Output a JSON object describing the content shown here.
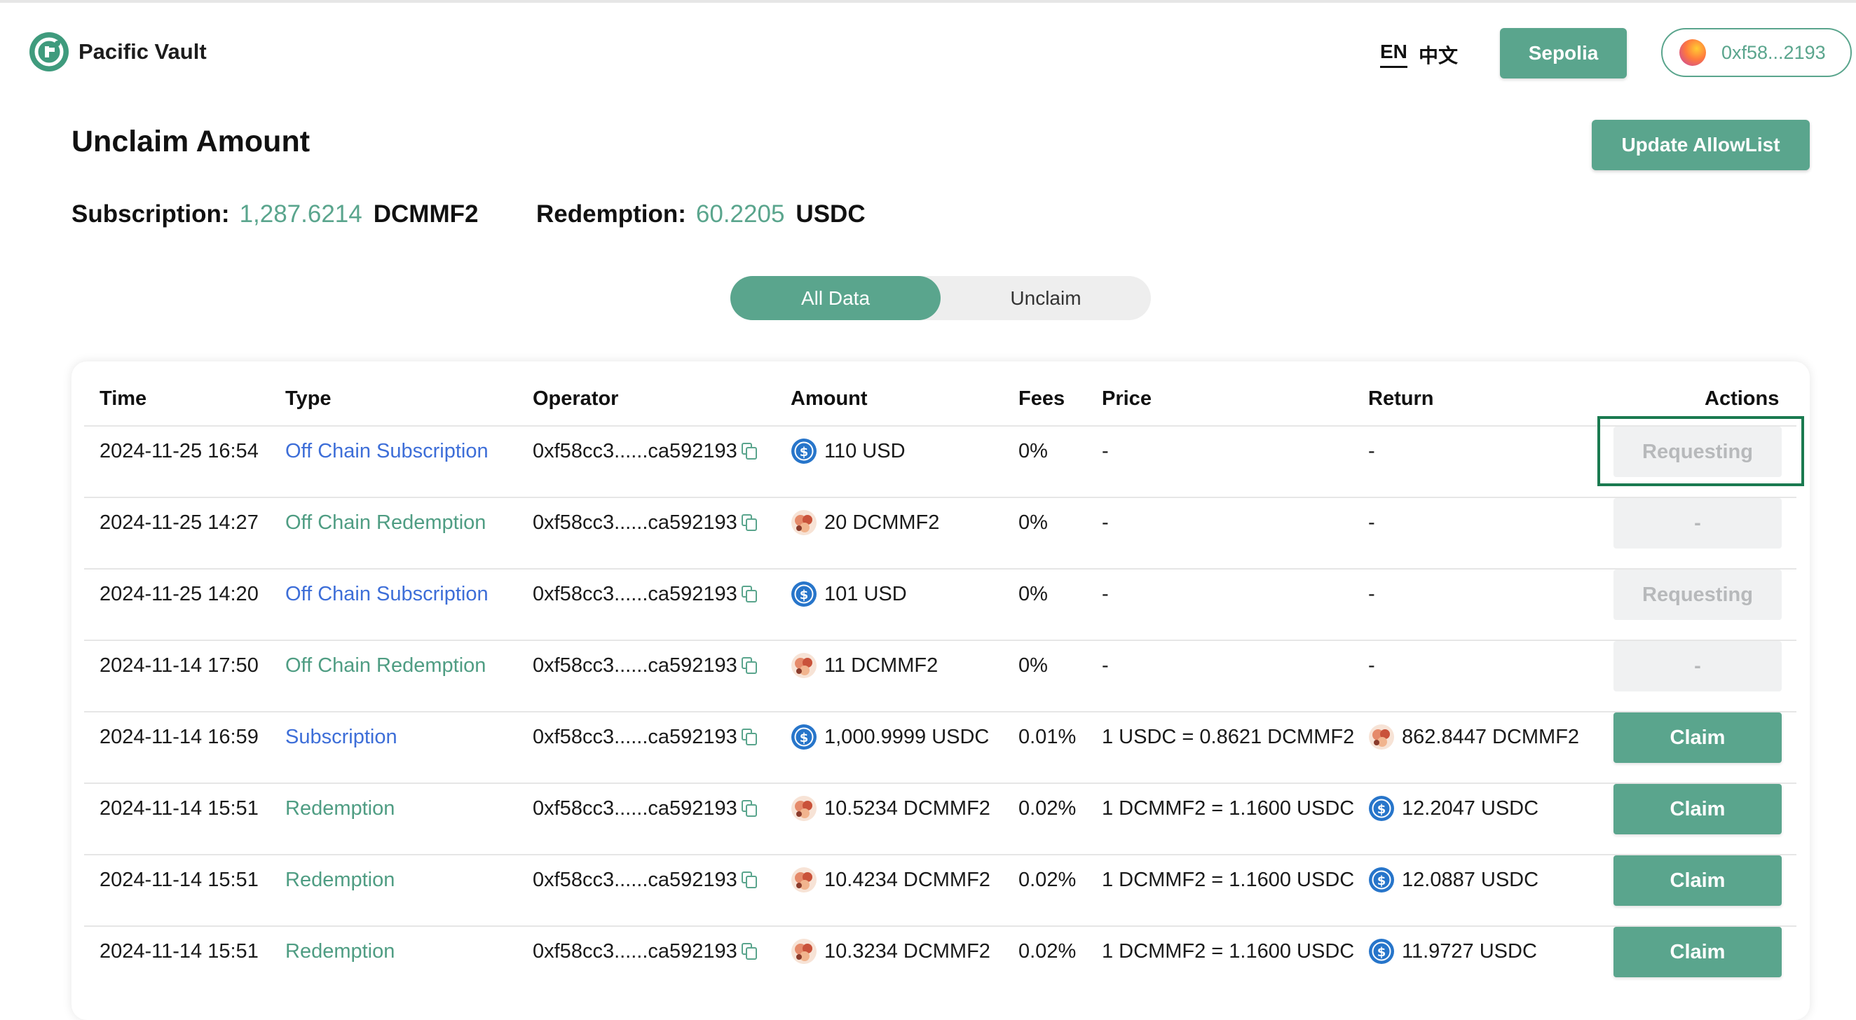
{
  "app": {
    "name": "Pacific Vault"
  },
  "header": {
    "lang_en": "EN",
    "lang_zh": "中文",
    "network": "Sepolia",
    "wallet": "0xf58...2193"
  },
  "page": {
    "title": "Unclaim Amount",
    "update_button": "Update AllowList",
    "subscription": {
      "label": "Subscription:",
      "value": "1,287.6214",
      "unit": "DCMMF2"
    },
    "redemption": {
      "label": "Redemption:",
      "value": "60.2205",
      "unit": "USDC"
    },
    "tabs": [
      "All Data",
      "Unclaim"
    ]
  },
  "table": {
    "headers": {
      "time": "Time",
      "type": "Type",
      "operator": "Operator",
      "amount": "Amount",
      "fees": "Fees",
      "price": "Price",
      "return": "Return",
      "actions": "Actions"
    },
    "rows": [
      {
        "time": "2024-11-25 16:54",
        "type": "Off Chain Subscription",
        "kind": "sub",
        "operator": "0xf58cc3......ca592193",
        "amount_coin": "usd",
        "amount": "110 USD",
        "fees": "0%",
        "price": "-",
        "return_coin": "",
        "return": "-",
        "action": "Requesting",
        "action_state": "disabled"
      },
      {
        "time": "2024-11-25 14:27",
        "type": "Off Chain Redemption",
        "kind": "red",
        "operator": "0xf58cc3......ca592193",
        "amount_coin": "dcmmf",
        "amount": "20 DCMMF2",
        "fees": "0%",
        "price": "-",
        "return_coin": "",
        "return": "-",
        "action": "-",
        "action_state": "disabled"
      },
      {
        "time": "2024-11-25 14:20",
        "type": "Off Chain Subscription",
        "kind": "sub",
        "operator": "0xf58cc3......ca592193",
        "amount_coin": "usd",
        "amount": "101 USD",
        "fees": "0%",
        "price": "-",
        "return_coin": "",
        "return": "-",
        "action": "Requesting",
        "action_state": "disabled"
      },
      {
        "time": "2024-11-14 17:50",
        "type": "Off Chain Redemption",
        "kind": "red",
        "operator": "0xf58cc3......ca592193",
        "amount_coin": "dcmmf",
        "amount": "11 DCMMF2",
        "fees": "0%",
        "price": "-",
        "return_coin": "",
        "return": "-",
        "action": "-",
        "action_state": "disabled"
      },
      {
        "time": "2024-11-14 16:59",
        "type": "Subscription",
        "kind": "sub",
        "operator": "0xf58cc3......ca592193",
        "amount_coin": "usd",
        "amount": "1,000.9999 USDC",
        "fees": "0.01%",
        "price": "1 USDC = 0.8621 DCMMF2",
        "return_coin": "dcmmf",
        "return": "862.8447 DCMMF2",
        "action": "Claim",
        "action_state": "claim"
      },
      {
        "time": "2024-11-14 15:51",
        "type": "Redemption",
        "kind": "red",
        "operator": "0xf58cc3......ca592193",
        "amount_coin": "dcmmf",
        "amount": "10.5234 DCMMF2",
        "fees": "0.02%",
        "price": "1 DCMMF2 = 1.1600 USDC",
        "return_coin": "usd",
        "return": "12.2047 USDC",
        "action": "Claim",
        "action_state": "claim"
      },
      {
        "time": "2024-11-14 15:51",
        "type": "Redemption",
        "kind": "red",
        "operator": "0xf58cc3......ca592193",
        "amount_coin": "dcmmf",
        "amount": "10.4234 DCMMF2",
        "fees": "0.02%",
        "price": "1 DCMMF2 = 1.1600 USDC",
        "return_coin": "usd",
        "return": "12.0887 USDC",
        "action": "Claim",
        "action_state": "claim"
      },
      {
        "time": "2024-11-14 15:51",
        "type": "Redemption",
        "kind": "red",
        "operator": "0xf58cc3......ca592193",
        "amount_coin": "dcmmf",
        "amount": "10.3234 DCMMF2",
        "fees": "0.02%",
        "price": "1 DCMMF2 = 1.1600 USDC",
        "return_coin": "usd",
        "return": "11.9727 USDC",
        "action": "Claim",
        "action_state": "claim"
      }
    ]
  },
  "colors": {
    "accent": "#5aa58d",
    "link_blue": "#3d6ed8",
    "focus": "#1a7a50"
  }
}
